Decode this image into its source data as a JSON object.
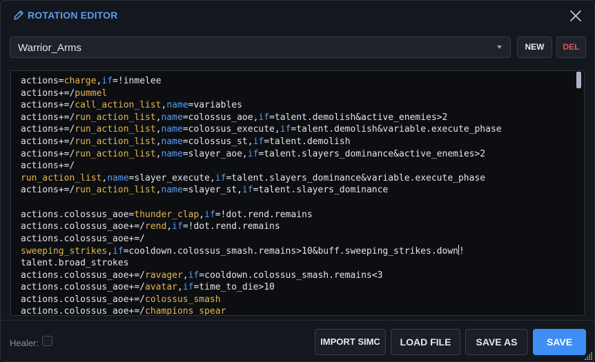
{
  "window": {
    "title": "ROTATION EDITOR",
    "title_icon": "pencil-icon",
    "close_icon": "close-icon"
  },
  "toolbar": {
    "profile_selected": "Warrior_Arms",
    "new_label": "NEW",
    "del_label": "DEL"
  },
  "editor": {
    "lines": [
      [
        [
          "actions=",
          ""
        ],
        [
          "charge",
          "kw"
        ],
        [
          ",",
          ""
        ],
        [
          "if",
          "key"
        ],
        [
          "=!inmelee",
          ""
        ]
      ],
      [
        [
          "actions+=/",
          ""
        ],
        [
          "pummel",
          "kw"
        ]
      ],
      [
        [
          "actions+=/",
          ""
        ],
        [
          "call_action_list",
          "kw"
        ],
        [
          ",",
          ""
        ],
        [
          "name",
          "key"
        ],
        [
          "=variables",
          ""
        ]
      ],
      [
        [
          "actions+=/",
          ""
        ],
        [
          "run_action_list",
          "kw"
        ],
        [
          ",",
          ""
        ],
        [
          "name",
          "key"
        ],
        [
          "=colossus_aoe,",
          ""
        ],
        [
          "if",
          "key"
        ],
        [
          "=talent.demolish&active_enemies>2",
          ""
        ]
      ],
      [
        [
          "actions+=/",
          ""
        ],
        [
          "run_action_list",
          "kw"
        ],
        [
          ",",
          ""
        ],
        [
          "name",
          "key"
        ],
        [
          "=colossus_execute,",
          ""
        ],
        [
          "if",
          "key"
        ],
        [
          "=talent.demolish&variable.execute_phase",
          ""
        ]
      ],
      [
        [
          "actions+=/",
          ""
        ],
        [
          "run_action_list",
          "kw"
        ],
        [
          ",",
          ""
        ],
        [
          "name",
          "key"
        ],
        [
          "=colossus_st,",
          ""
        ],
        [
          "if",
          "key"
        ],
        [
          "=talent.demolish",
          ""
        ]
      ],
      [
        [
          "actions+=/",
          ""
        ],
        [
          "run_action_list",
          "kw"
        ],
        [
          ",",
          ""
        ],
        [
          "name",
          "key"
        ],
        [
          "=slayer_aoe,",
          ""
        ],
        [
          "if",
          "key"
        ],
        [
          "=talent.slayers_dominance&active_enemies>2",
          ""
        ]
      ],
      [
        [
          "actions+=/",
          ""
        ]
      ],
      [
        [
          "run_action_list",
          "kw"
        ],
        [
          ",",
          ""
        ],
        [
          "name",
          "key"
        ],
        [
          "=slayer_execute,",
          ""
        ],
        [
          "if",
          "key"
        ],
        [
          "=talent.slayers_dominance&variable.execute_phase",
          ""
        ]
      ],
      [
        [
          "actions+=/",
          ""
        ],
        [
          "run_action_list",
          "kw"
        ],
        [
          ",",
          ""
        ],
        [
          "name",
          "key"
        ],
        [
          "=slayer_st,",
          ""
        ],
        [
          "if",
          "key"
        ],
        [
          "=talent.slayers_dominance",
          ""
        ]
      ],
      [],
      [
        [
          "actions.colossus_aoe=",
          ""
        ],
        [
          "thunder_clap",
          "kw"
        ],
        [
          ",",
          ""
        ],
        [
          "if",
          "key"
        ],
        [
          "=!dot.rend.remains",
          ""
        ]
      ],
      [
        [
          "actions.colossus_aoe+=/",
          ""
        ],
        [
          "rend",
          "kw"
        ],
        [
          ",",
          ""
        ],
        [
          "if",
          "key"
        ],
        [
          "=!dot.rend.remains",
          ""
        ]
      ],
      [
        [
          "actions.colossus_aoe+=/",
          ""
        ]
      ],
      [
        [
          "sweeping_strikes",
          "kw"
        ],
        [
          ",",
          ""
        ],
        [
          "if",
          "key"
        ],
        [
          "=cooldown.colossus_smash.remains>10&buff.sweeping_strikes.down",
          ""
        ],
        [
          "|",
          "cursor"
        ],
        [
          "!",
          ""
        ]
      ],
      [
        [
          "talent.broad_strokes",
          ""
        ]
      ],
      [
        [
          "actions.colossus_aoe+=/",
          ""
        ],
        [
          "ravager",
          "kw"
        ],
        [
          ",",
          ""
        ],
        [
          "if",
          "key"
        ],
        [
          "=cooldown.colossus_smash.remains<3",
          ""
        ]
      ],
      [
        [
          "actions.colossus_aoe+=/",
          ""
        ],
        [
          "avatar",
          "kw"
        ],
        [
          ",",
          ""
        ],
        [
          "if",
          "key"
        ],
        [
          "=time_to_die>10",
          ""
        ]
      ],
      [
        [
          "actions.colossus_aoe+=/",
          ""
        ],
        [
          "colossus_smash",
          "kw"
        ]
      ],
      [
        [
          "actions.colossus_aoe+=/",
          ""
        ],
        [
          "champions_spear",
          "kw"
        ]
      ]
    ]
  },
  "footer": {
    "healer_label": "Healer:",
    "healer_checked": false,
    "import_label": "IMPORT SIMC",
    "load_label": "LOAD FILE",
    "saveas_label": "SAVE AS",
    "save_label": "SAVE"
  },
  "colors": {
    "accent": "#3e8ef5",
    "title": "#5a9cf0",
    "action_name": "#e8b64d",
    "keyword": "#5a9cf0",
    "delete": "#e05555"
  }
}
